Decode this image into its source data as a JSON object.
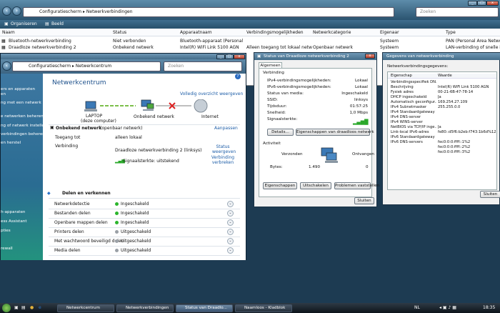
{
  "explorer": {
    "breadcrumb": [
      "Configuratiescherm",
      "Netwerkverbindingen"
    ],
    "search_placeholder": "Zoeken",
    "toolbar": {
      "organize": "Organiseren",
      "view": "Beeld"
    },
    "columns": [
      "Naam",
      "Status",
      "Apparaatnaam",
      "Verbindingsmogelijkheden",
      "Netwerkcategorie",
      "Eigenaar",
      "Type"
    ],
    "rows": [
      [
        "Bluetooth-netwerkverbinding",
        "Niet verbonden",
        "Bluetooth-apparaat (Personal A...",
        "",
        "",
        "Systeem",
        "PAN (Personal Area Network)"
      ],
      [
        "Draadloze netwerkverbinding 2",
        "Onbekend netwerk",
        "Intel(R) WiFi Link 5100 AGN",
        "Alleen toegang tot lokaal netwerk",
        "Openbaar netwerk",
        "Systeem",
        "LAN-verbinding of snelle internet..."
      ]
    ]
  },
  "network_center": {
    "breadcrumb": [
      "Configuratiescherm",
      "Netwerkcentrum"
    ],
    "search_placeholder": "Zoeken",
    "sidebar_items": [
      "ers en apparaten",
      "en",
      "ng met een netwerk",
      "e netwerken beheren",
      "ng of netwerk instellen",
      "verbindingen beheren",
      "en herstel",
      "h-apparaten",
      "ess Assistant",
      "pties",
      "rewall"
    ],
    "title": "Netwerkcentrum",
    "full_overview_link": "Volledig overzicht weergeven",
    "map": {
      "computer": "LAPTOP",
      "computer_sub": "(deze computer)",
      "network": "Onbekend netwerk",
      "internet": "Internet"
    },
    "network_name": "Onbekend netwerk",
    "network_type": "(openbaar netwerk)",
    "customize_link": "Aanpassen",
    "access_label": "Toegang tot",
    "access_value": "alleen lokaal",
    "connection_label": "Verbinding",
    "connection_value": "Draadloze netwerkverbinding 2 (linksys)",
    "status_link": "Status weergeven",
    "signal_label": "Signaalsterkte: uitstekend",
    "disconnect_link": "Verbinding verbreken",
    "sharing_title": "Delen en verkennen",
    "sharing": [
      {
        "label": "Netwerkdetectie",
        "value": "Ingeschakeld",
        "status": "on"
      },
      {
        "label": "Bestanden delen",
        "value": "Ingeschakeld",
        "status": "on"
      },
      {
        "label": "Openbare mappen delen",
        "value": "Ingeschakeld",
        "status": "on"
      },
      {
        "label": "Printers delen",
        "value": "Uitgeschakeld",
        "status": "off"
      },
      {
        "label": "Met wachtwoord beveiligd delen",
        "value": "Uitgeschakeld",
        "status": "off"
      },
      {
        "label": "Media delen",
        "value": "Uitgeschakeld",
        "status": "off"
      }
    ],
    "colors": {
      "on": "#2bb52b",
      "off": "#9aa0a6"
    }
  },
  "status_dialog": {
    "title": "Status van Draadloze netwerkverbinding 2",
    "tab": "Algemeen",
    "connection_section": "Verbinding",
    "fields": [
      {
        "label": "IPv4-verbindingsmogelijkheden:",
        "value": "Lokaal"
      },
      {
        "label": "IPv6-verbindingsmogelijkheden:",
        "value": "Lokaal"
      },
      {
        "label": "Status van media:",
        "value": "Ingeschakeld"
      },
      {
        "label": "SSID:",
        "value": "linksys"
      },
      {
        "label": "Tijdsduur:",
        "value": "01:57:25"
      },
      {
        "label": "Snelheid:",
        "value": "1,0 Mbps"
      },
      {
        "label": "Signaalsterkte:",
        "value": ""
      }
    ],
    "details_button": "Details...",
    "wireless_props_button": "Eigenschappen van draadloos netwerk",
    "activity_section": "Activiteit",
    "sent_label": "Verzonden",
    "received_label": "Ontvangen",
    "bytes_label": "Bytes:",
    "bytes_sent": "1.490",
    "bytes_received": "0",
    "properties_button": "Eigenschappen",
    "disable_button": "Uitschakelen",
    "diagnose_button": "Problemen vaststellen",
    "close_button": "Sluiten"
  },
  "details_dialog": {
    "title": "Gegevens van netwerkverbinding",
    "subtitle": "Netwerkverbindingsgegevens:",
    "header": [
      "Eigenschap",
      "Waarde"
    ],
    "rows": [
      [
        "Verbindingsspecifiek DN...",
        ""
      ],
      [
        "Beschrijving",
        "Intel(R) WiFi Link 5100 AGN"
      ],
      [
        "Fysiek adres",
        "00-21-6B-47-78-14"
      ],
      [
        "DHCP ingeschakeld",
        "Ja"
      ],
      [
        "Automatisch geconfigur...",
        "169.254.27.109"
      ],
      [
        "IPv4 Subnetmasker",
        "255.255.0.0"
      ],
      [
        "IPv4 Standaardgateway",
        ""
      ],
      [
        "IPv4 DNS-server",
        ""
      ],
      [
        "IPv4 WINS-server",
        ""
      ],
      [
        "NetBIOS via TCP/IP inge...",
        "Ja"
      ],
      [
        "Link-local IPv6-adres",
        "fe80::d5f6:b2eb:f743:1b6d%12"
      ],
      [
        "IPv6 Standaardgateway",
        ""
      ],
      [
        "IPv6 DNS-servers",
        "fec0:0:0:ffff::1%2"
      ],
      [
        "",
        "fec0:0:0:ffff::2%2"
      ],
      [
        "",
        "fec0:0:0:ffff::3%2"
      ]
    ],
    "close_button": "Sluiten"
  },
  "taskbar": {
    "tasks": [
      "Netwerkcentrum",
      "Netwerkverbindingen",
      "Status van Draadlo...",
      "Naamloos - Kladblok"
    ],
    "lang": "NL",
    "clock": "18:35"
  }
}
